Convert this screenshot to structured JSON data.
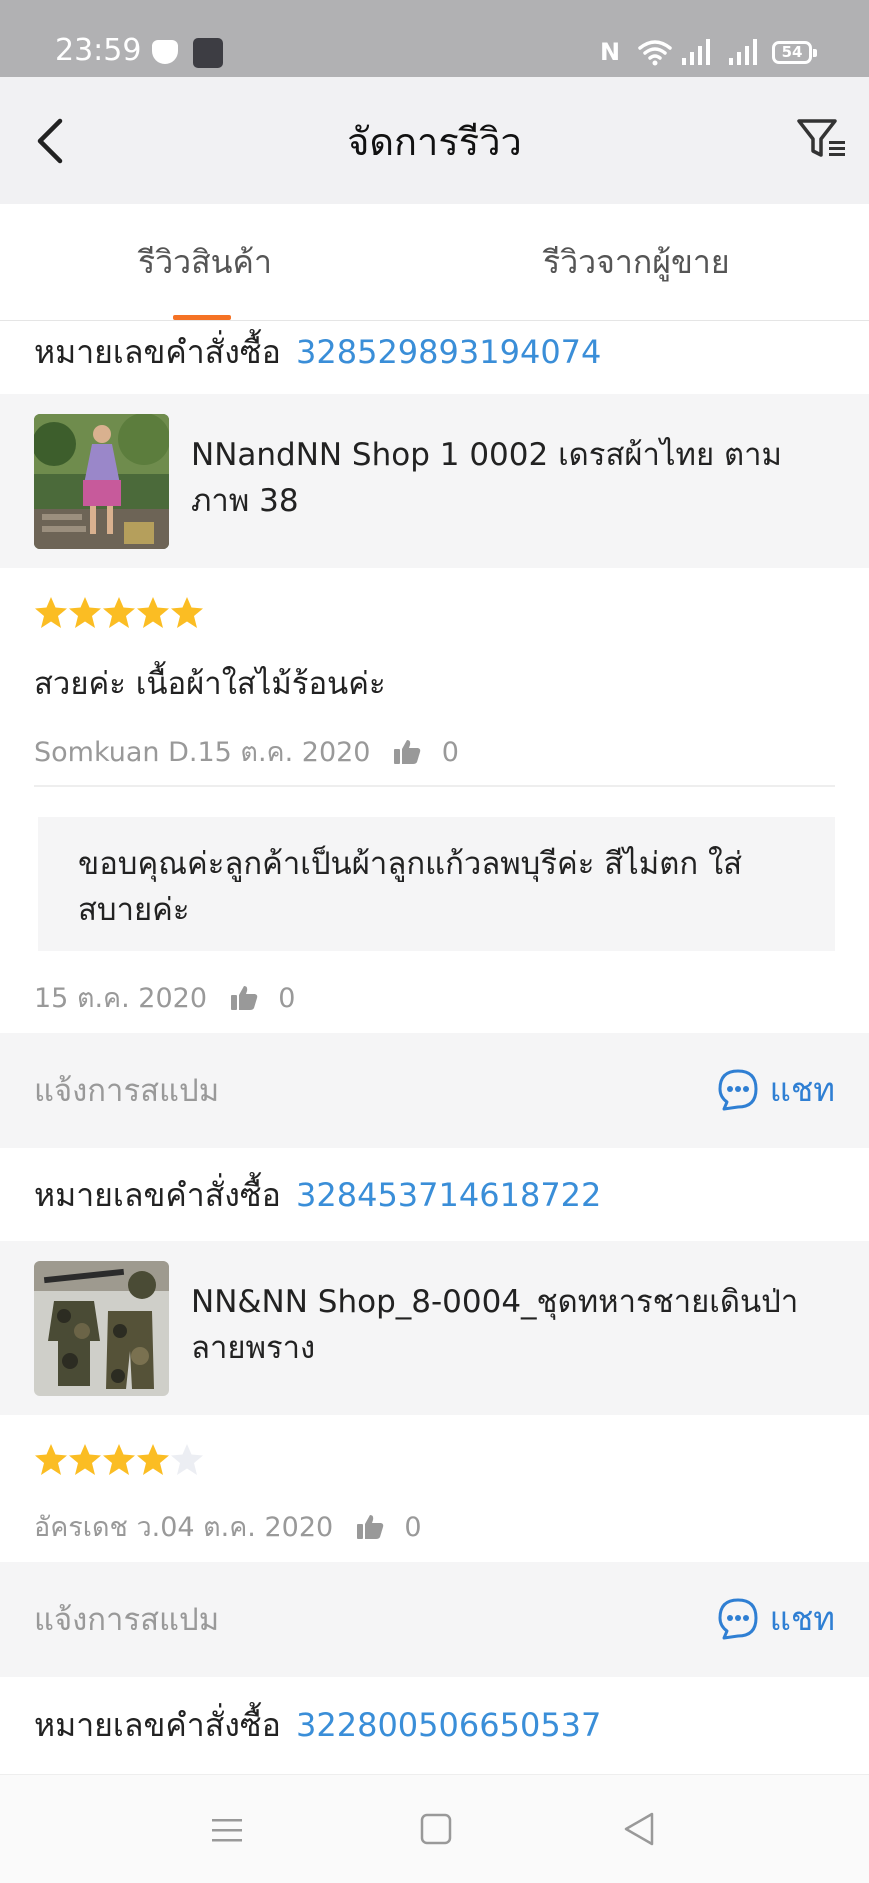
{
  "status_bar": {
    "time": "23:59",
    "nfc": "N",
    "battery": "54"
  },
  "header": {
    "title": "จัดการรีวิว"
  },
  "tabs": [
    {
      "label": "รีวิวสินค้า",
      "active": true
    },
    {
      "label": "รีวิวจากผู้ขาย",
      "active": false
    }
  ],
  "colors": {
    "accent": "#f57224",
    "link": "#3a8ed8",
    "chat": "#2f7fd3",
    "star": "#fbbd23",
    "star_empty": "#eceef3"
  },
  "reviews": [
    {
      "order_label": "หมายเลขคำสั่งซื้อ",
      "order_number": "328529893194074",
      "product_name": "NNandNN Shop 1 0002 เดรสผ้าไทย ตาม ภาพ 38",
      "rating": 5,
      "review_text": "สวยค่ะ เนื้อผ้าใสไม้ร้อนค่ะ",
      "reviewer_date": "Somkuan D.15 ต.ค. 2020",
      "likes": "0",
      "seller_reply": "ขอบคุณค่ะลูกค้าเป็นผ้าลูกแก้วลพบุรีค่ะ สีไม่ตก ใส่สบายค่ะ",
      "reply_date": "15 ต.ค. 2020",
      "reply_likes": "0",
      "report_spam": "แจ้งการสแปม",
      "chat": "แชท"
    },
    {
      "order_label": "หมายเลขคำสั่งซื้อ",
      "order_number": "328453714618722",
      "product_name": "NN&NN Shop_8-0004_ชุดทหารชายเดินป่า ลายพราง",
      "rating": 4,
      "reviewer_date": "อัครเดช ว.04 ต.ค. 2020",
      "likes": "0",
      "report_spam": "แจ้งการสแปม",
      "chat": "แชท"
    },
    {
      "order_label": "หมายเลขคำสั่งซื้อ",
      "order_number": "322800506650537"
    }
  ],
  "icons": {
    "back": "chevron-left-icon",
    "filter": "filter-icon",
    "like": "thumbs-up-icon",
    "chat": "chat-bubble-icon",
    "star": "star-icon"
  }
}
